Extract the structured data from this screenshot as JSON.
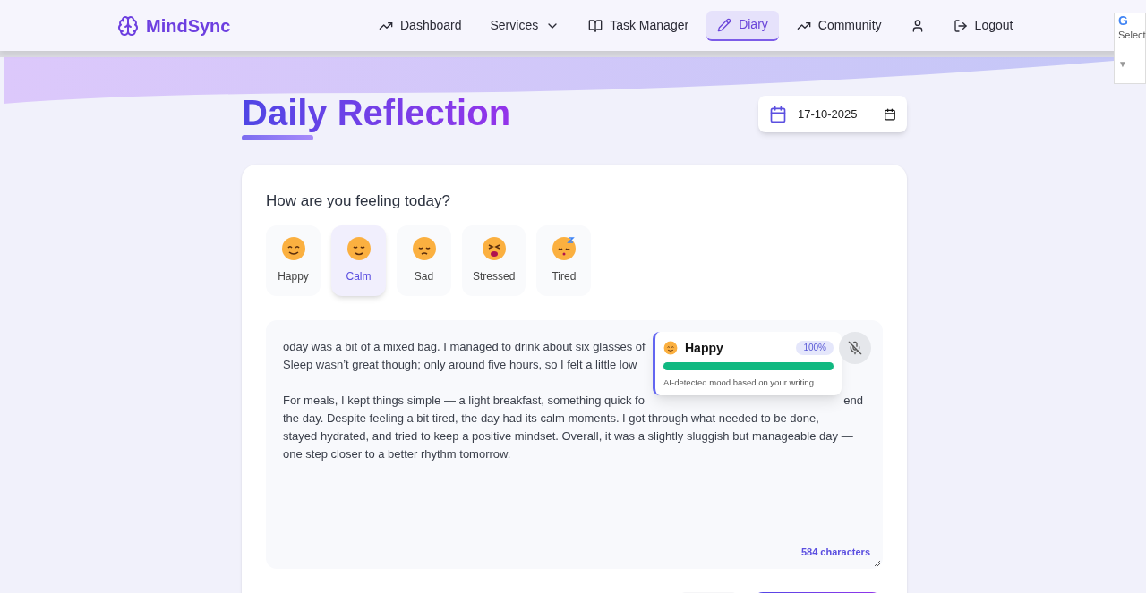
{
  "brand": {
    "name": "MindSync"
  },
  "nav": [
    {
      "label": "Dashboard",
      "kind": "trend",
      "selected": false
    },
    {
      "label": "Services",
      "kind": "dropdown",
      "selected": false
    },
    {
      "label": "Task Manager",
      "kind": "book",
      "selected": false
    },
    {
      "label": "Diary",
      "kind": "pencil",
      "selected": true
    },
    {
      "label": "Community",
      "kind": "trend",
      "selected": false
    },
    {
      "kind": "user",
      "selected": false
    },
    {
      "label": "Logout",
      "kind": "logout",
      "selected": false
    }
  ],
  "translate_widget": {
    "logo": "G",
    "label": "Select",
    "arrow": "▼"
  },
  "page": {
    "title": "Daily Reflection",
    "date": "17-10-2025"
  },
  "mood_picker": {
    "question": "How are you feeling today?",
    "moods": [
      {
        "label": "Happy",
        "kind": "happy",
        "selected": false
      },
      {
        "label": "Calm",
        "kind": "calm",
        "selected": true
      },
      {
        "label": "Sad",
        "kind": "sad",
        "selected": false
      },
      {
        "label": "Stressed",
        "kind": "stressed",
        "selected": false
      },
      {
        "label": "Tired",
        "kind": "tired",
        "selected": false
      }
    ]
  },
  "entry": {
    "paragraphs": [
      [
        {
          "left": "oday was a bit of a mixed bag. I managed to drink about six glasses of"
        },
        {
          "left": "Sleep wasn’t great though; only around five hours, so I felt a little low"
        }
      ],
      [
        {
          "left": "For meals, I kept things simple — a light breakfast, something quick fo",
          "right": "end"
        },
        {
          "left": "the day. Despite feeling a bit tired, the day had its calm moments. I got through what needed to be done,"
        },
        {
          "left": "stayed hydrated, and tried to keep a positive mindset. Overall, it was a slightly sluggish but manageable day —"
        },
        {
          "left": "one step closer to a better rhythm tomorrow."
        }
      ]
    ],
    "char_count": "584 characters",
    "mic_muted": true
  },
  "detected_mood": {
    "kind": "happy",
    "label": "Happy",
    "percent": "100%",
    "level": 1,
    "caption": "AI-detected mood based on your writing"
  }
}
